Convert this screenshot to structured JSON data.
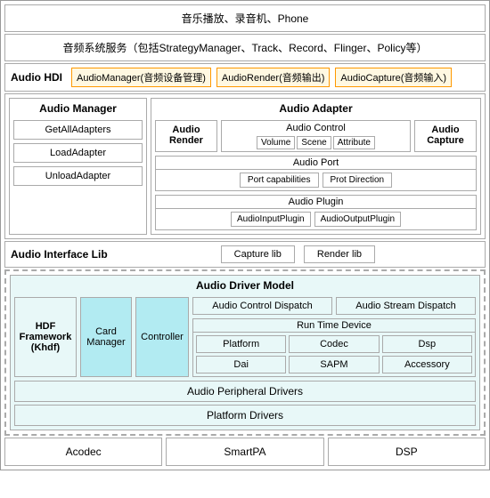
{
  "top": {
    "music_label": "音乐播放、录音机、Phone",
    "services_label": "音频系统服务（包括StrategyManager、Track、Record、Flinger、Policy等）"
  },
  "hdi": {
    "label": "Audio HDI",
    "badge1": "AudioManager(音频设备管理)",
    "badge2": "AudioRender(音频输出)",
    "badge3": "AudioCapture(音频输入)"
  },
  "audio_manager": {
    "title": "Audio Manager",
    "items": [
      "GetAllAdapters",
      "LoadAdapter",
      "UnloadAdapter"
    ]
  },
  "audio_adapter": {
    "title": "Audio Adapter",
    "render_label": "Audio\nRender",
    "capture_label": "Audio\nCapture",
    "control": {
      "title": "Audio Control",
      "badges": [
        "Volume",
        "Scene",
        "Attribute"
      ]
    },
    "port": {
      "title": "Audio Port",
      "items": [
        "Port capabilities",
        "Prot Direction"
      ]
    },
    "plugin": {
      "title": "Audio Plugin",
      "items": [
        "AudioInputPlugin",
        "AudioOutputPlugin"
      ]
    }
  },
  "iface_lib": {
    "label": "Audio Interface Lib",
    "items": [
      "Capture lib",
      "Render lib"
    ]
  },
  "driver": {
    "model_title": "Audio Driver Model",
    "hdf_label": "HDF\nFramework\n(Khdf)",
    "card_manager": "Card\nManager",
    "controller": "Controller",
    "dispatch": {
      "item1": "Audio Control Dispatch",
      "item2": "Audio Stream Dispatch"
    },
    "runtime": {
      "title": "Run Time Device",
      "items": [
        "Platform",
        "Codec",
        "Dsp",
        "Dai",
        "SAPM",
        "Accessory"
      ]
    },
    "peripheral": "Audio Peripheral Drivers",
    "platform": "Platform Drivers"
  },
  "bottom": {
    "items": [
      "Acodec",
      "SmartPA",
      "DSP"
    ]
  }
}
